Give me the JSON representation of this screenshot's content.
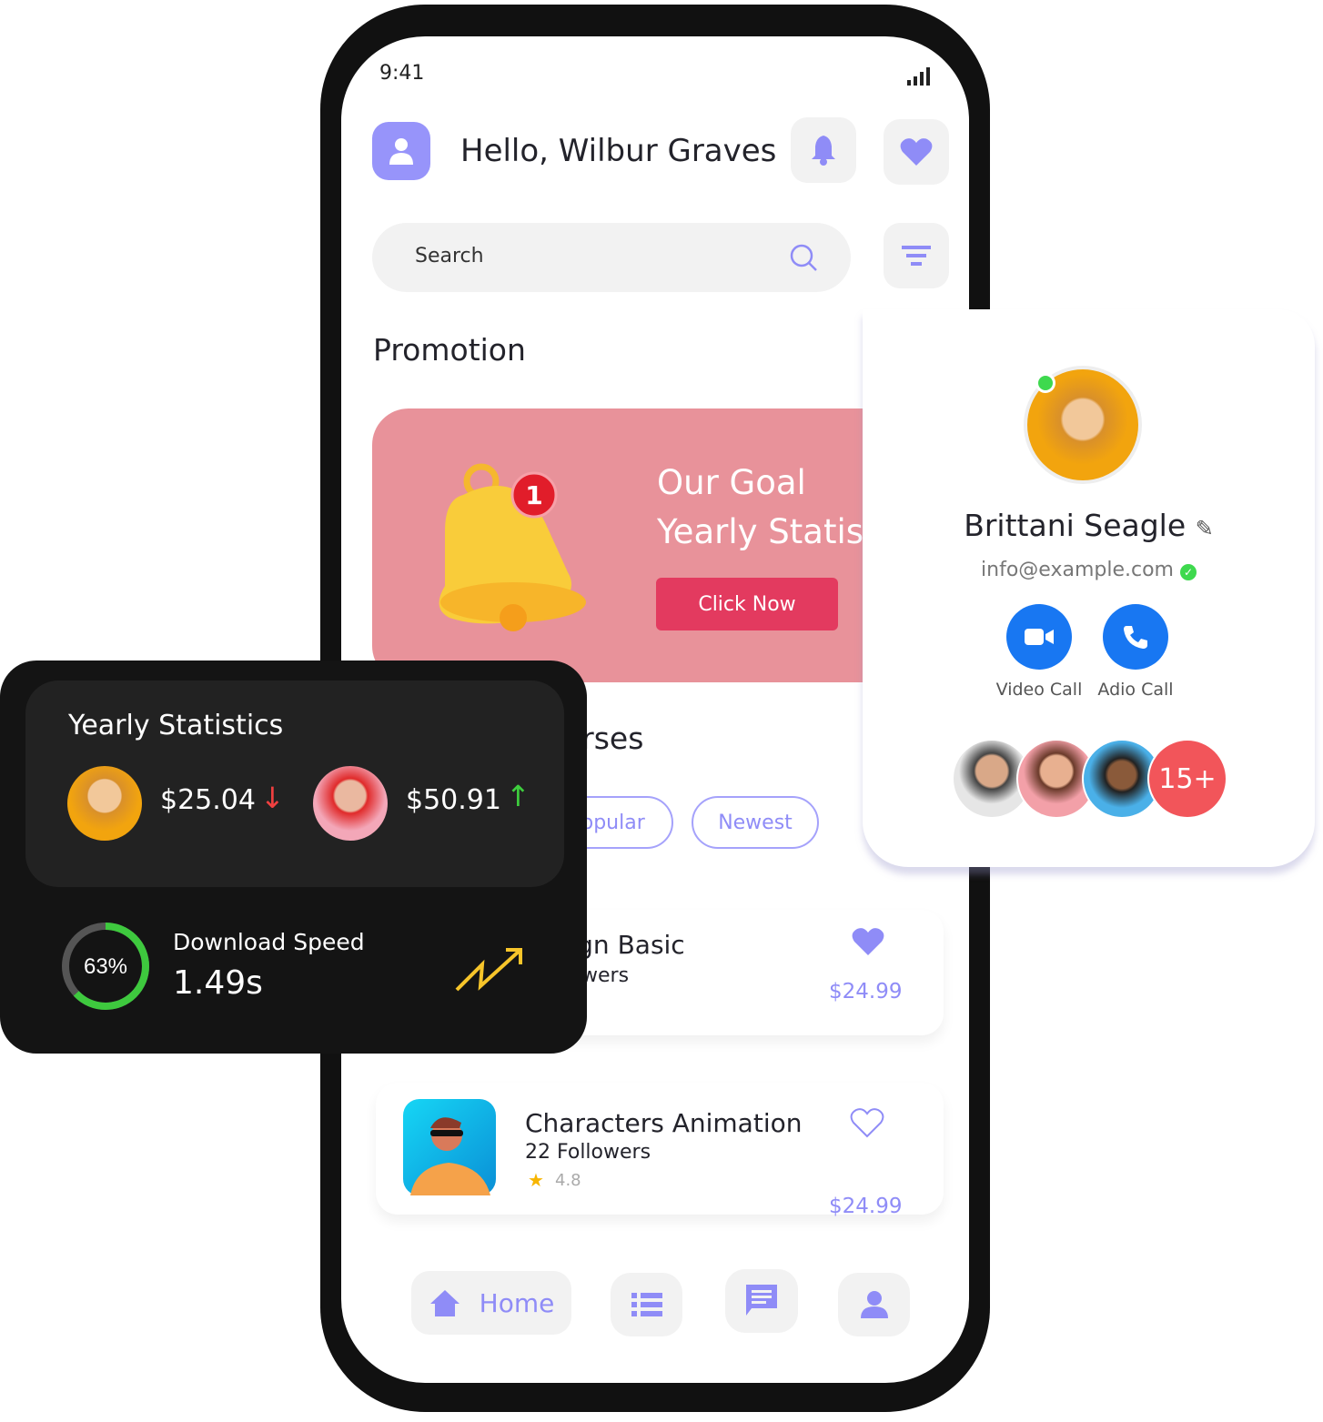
{
  "status_bar": {
    "time": "9:41",
    "signal_icon": "signal-bars-icon"
  },
  "header": {
    "greeting": "Hello, Wilbur Graves",
    "avatar_icon": "user-icon",
    "bell_icon": "bell-icon",
    "heart_icon": "heart-icon"
  },
  "search": {
    "placeholder": "Search",
    "filter_icon": "filter-icon"
  },
  "promotion": {
    "title": "Promotion",
    "line1": "Our Goal",
    "line2": "Yearly Statistics",
    "button": "Click Now",
    "badge": "1",
    "colors": {
      "card": "#e8929a",
      "button": "#e33a5f"
    }
  },
  "courses": {
    "title": "Courses",
    "chips": [
      "Popular",
      "Newest"
    ],
    "items": [
      {
        "title": "Design Basic",
        "followers": "Followers",
        "price": "$24.99",
        "liked": true
      },
      {
        "title": "Characters Animation",
        "followers": "22 Followers",
        "rating": "4.8",
        "price": "$24.99",
        "liked": false
      }
    ]
  },
  "nav": {
    "home": "Home",
    "items": [
      "home-icon",
      "list-icon",
      "chat-icon",
      "profile-icon"
    ]
  },
  "stats": {
    "title": "Yearly Statistics",
    "values": [
      {
        "amount": "$25.04",
        "trend": "down"
      },
      {
        "amount": "$50.91",
        "trend": "up"
      }
    ],
    "download_label": "Download Speed",
    "download_value": "1.49s",
    "progress_text": "63%",
    "progress": 63
  },
  "profile": {
    "name": "Brittani Seagle",
    "email": "info@example.com",
    "online": true,
    "video_call": "Video Call",
    "audio_call": "Adio Call",
    "more_count": "15+",
    "accent": "#1877f2"
  },
  "accent": "#8f8cf7"
}
